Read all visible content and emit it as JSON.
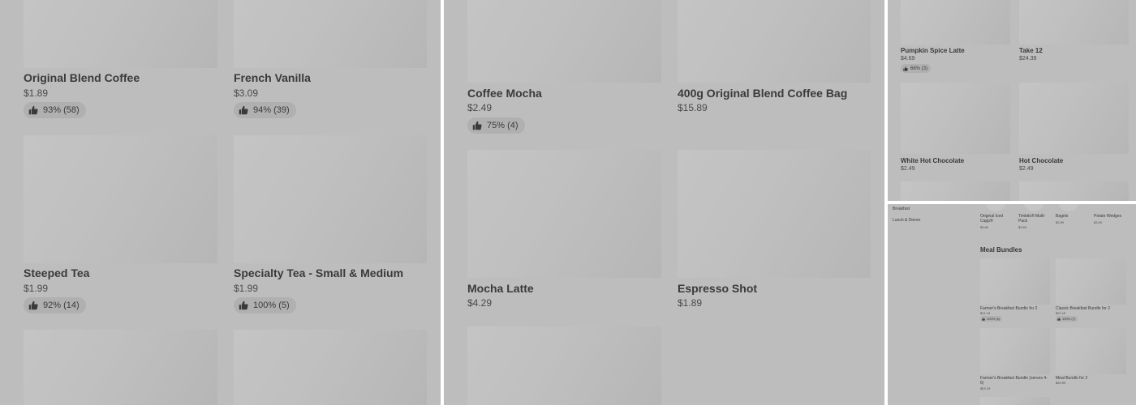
{
  "panel1": {
    "items": [
      {
        "name": "Original Blend Coffee",
        "price": "$1.89",
        "rating": "93% (58)"
      },
      {
        "name": "French Vanilla",
        "price": "$3.09",
        "rating": "94% (39)"
      },
      {
        "name": "Steeped Tea",
        "price": "$1.99",
        "rating": "92% (14)"
      },
      {
        "name": "Specialty Tea - Small & Medium",
        "price": "$1.99",
        "rating": "100% (5)"
      }
    ]
  },
  "panel2": {
    "items": [
      {
        "name": "Coffee Mocha",
        "price": "$2.49",
        "rating": "75% (4)"
      },
      {
        "name": "400g Original Blend Coffee Bag",
        "price": "$15.89"
      },
      {
        "name": "Mocha Latte",
        "price": "$4.29"
      },
      {
        "name": "Espresso Shot",
        "price": "$1.89"
      }
    ]
  },
  "panel3": {
    "items": [
      {
        "name": "Pumpkin Spice Latte",
        "price": "$4.69",
        "rating": "66% (3)"
      },
      {
        "name": "Take 12",
        "price": "$24.39"
      },
      {
        "name": "White Hot Chocolate",
        "price": "$2.49"
      },
      {
        "name": "Hot Chocolate",
        "price": "$2.49"
      }
    ]
  },
  "panel4": {
    "sidebar": [
      "Breakfast",
      "Lunch & Dinner"
    ],
    "top_row": [
      {
        "name": "Original Iced Capp®",
        "price": "$3.69"
      },
      {
        "name": "Timbits® Multi-Pack",
        "price": "$3.69"
      },
      {
        "name": "Bagels",
        "price": "$2.89"
      },
      {
        "name": "Potato Wedges",
        "price": "$3.09"
      }
    ],
    "section_title": "Meal Bundles",
    "bundles": [
      {
        "name": "Farmer's Breakfast Bundle for 2",
        "price": "$21.19",
        "rating": "100% (6)"
      },
      {
        "name": "Classic Breakfast Bundle for 2",
        "price": "$21.19",
        "rating": "100% (7)"
      },
      {
        "name": "Farmer's Breakfast Bundle (serves 4-6)",
        "price": "$53.19"
      },
      {
        "name": "Meal Bundle for 2",
        "price": "$20.99"
      }
    ]
  },
  "icons": {
    "rating": "thumbs-up-icon"
  },
  "colors": {
    "overlay": "#bdbdbd",
    "image_placeholder": "#c2c2c2",
    "rating_pill": "#b0b0b0",
    "divider": "#ffffff"
  }
}
